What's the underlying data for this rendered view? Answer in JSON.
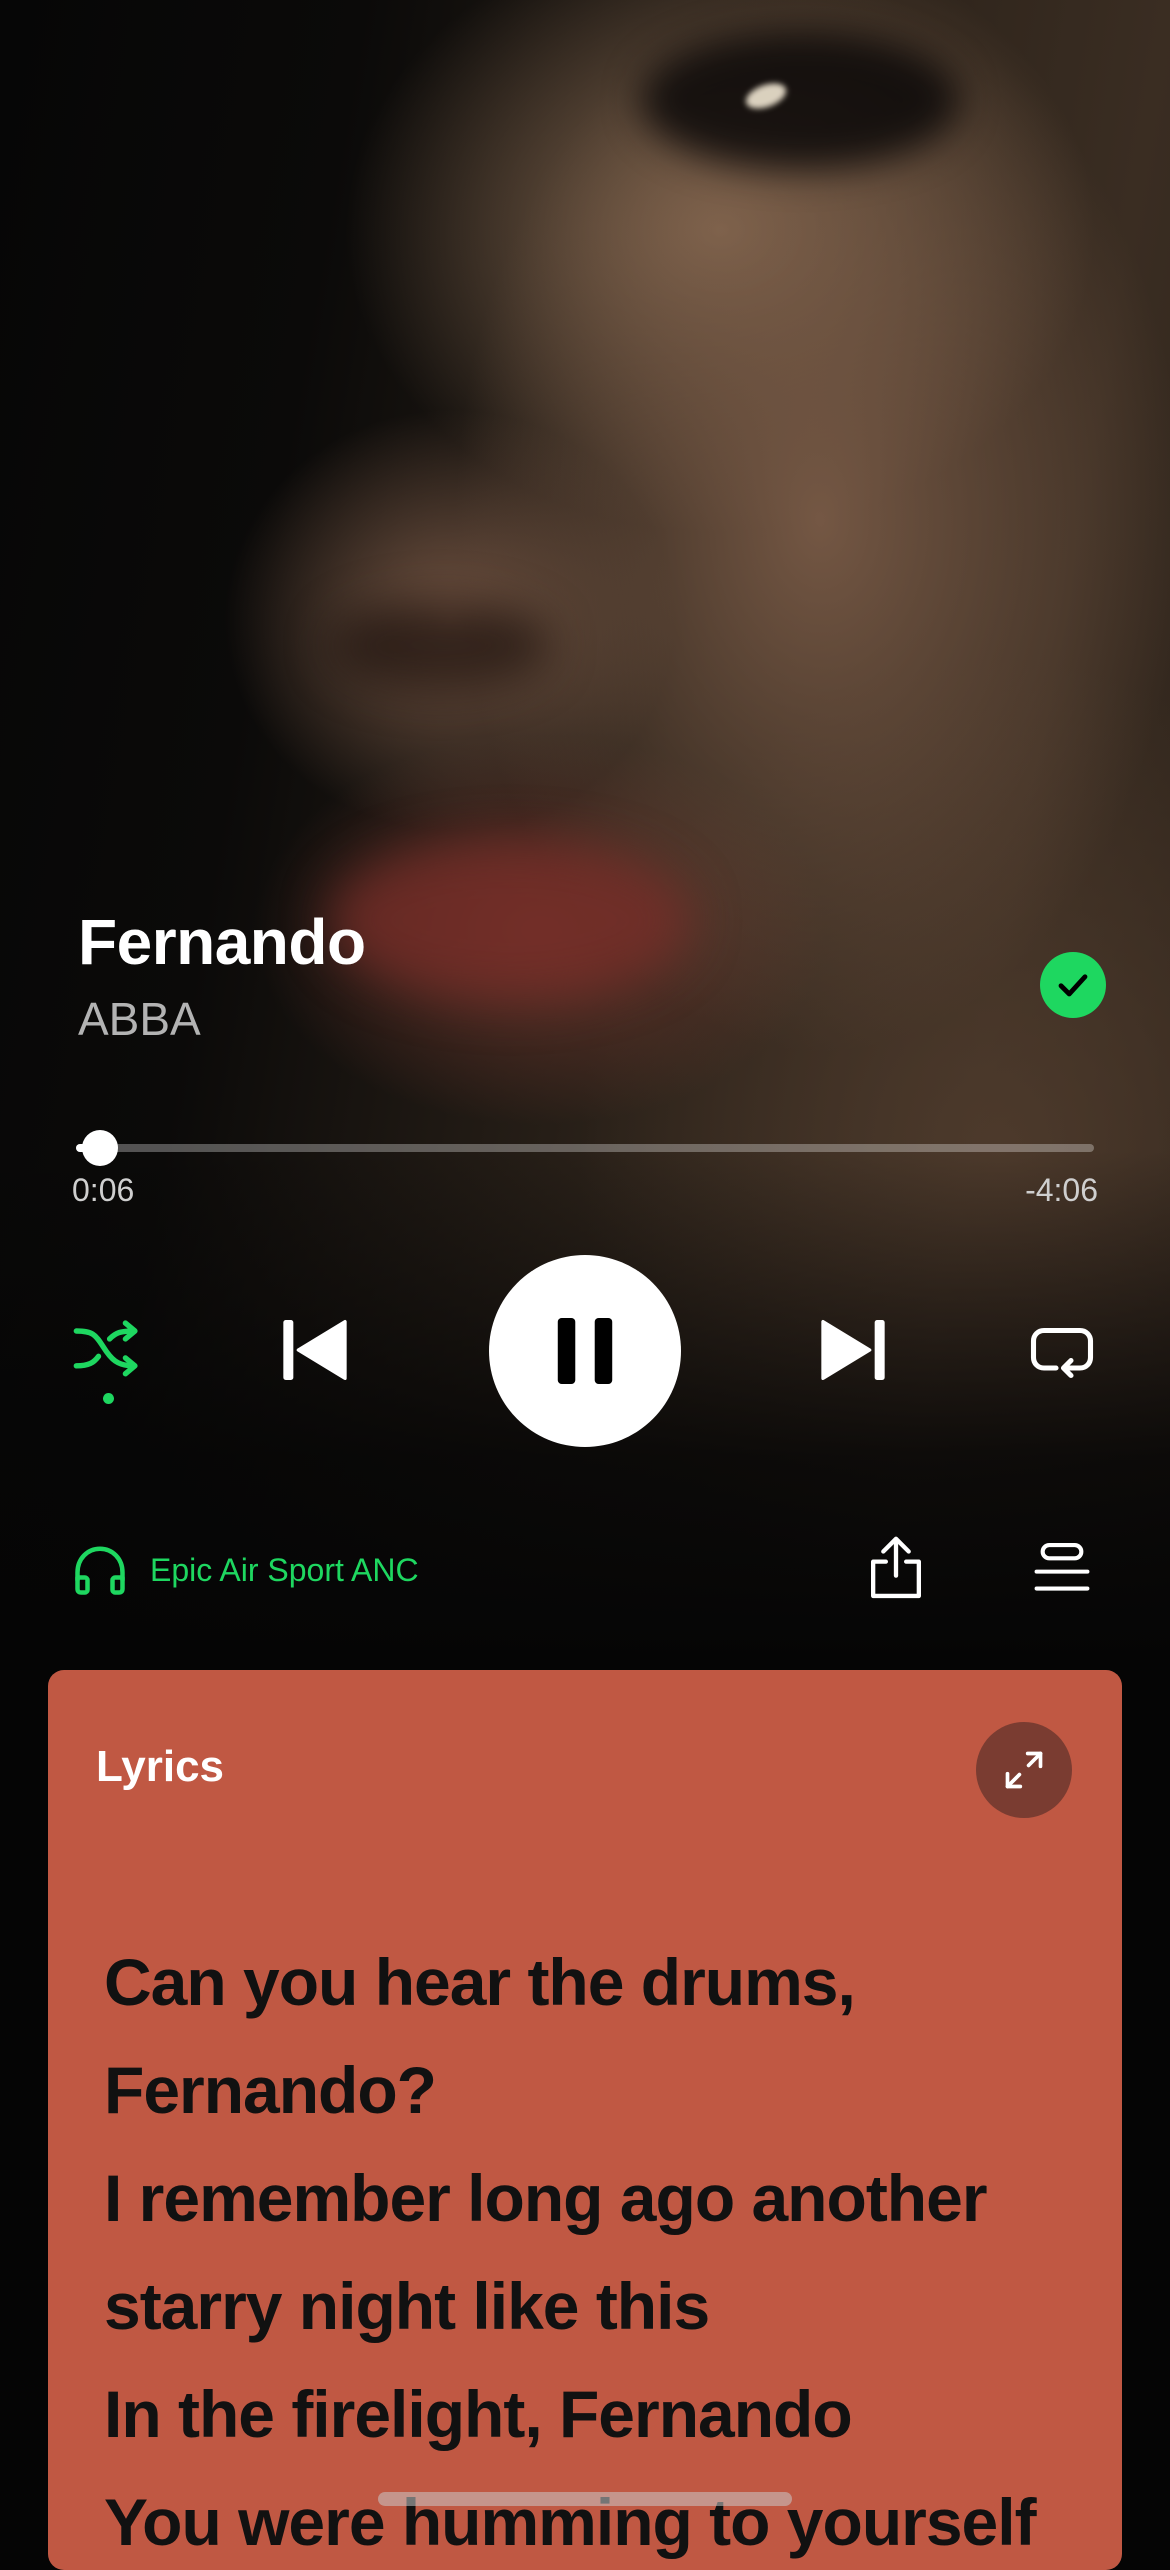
{
  "track": {
    "title": "Fernando",
    "artist": "ABBA",
    "liked": true
  },
  "progress": {
    "elapsed": "0:06",
    "remaining": "-4:06",
    "fraction": 0.024
  },
  "controls": {
    "shuffle_active": true,
    "playing": true,
    "icons": [
      "shuffle-icon",
      "skip-previous-icon",
      "pause-icon",
      "skip-next-icon",
      "repeat-icon"
    ]
  },
  "device": {
    "name": "Epic Air Sport ANC",
    "icon": "headphones-icon"
  },
  "actions": {
    "icons": [
      "share-icon",
      "queue-icon"
    ]
  },
  "lyrics": {
    "label": "Lyrics",
    "card_color": "#c05843",
    "lines": [
      "Can you hear the drums,",
      "Fernando?",
      "I remember long ago another",
      "starry night like this",
      "In the firelight, Fernando",
      "You were humming to yourself"
    ]
  },
  "colors": {
    "accent": "#1ed760",
    "background": "#050505",
    "secondary_text": "#b3b3b3"
  }
}
